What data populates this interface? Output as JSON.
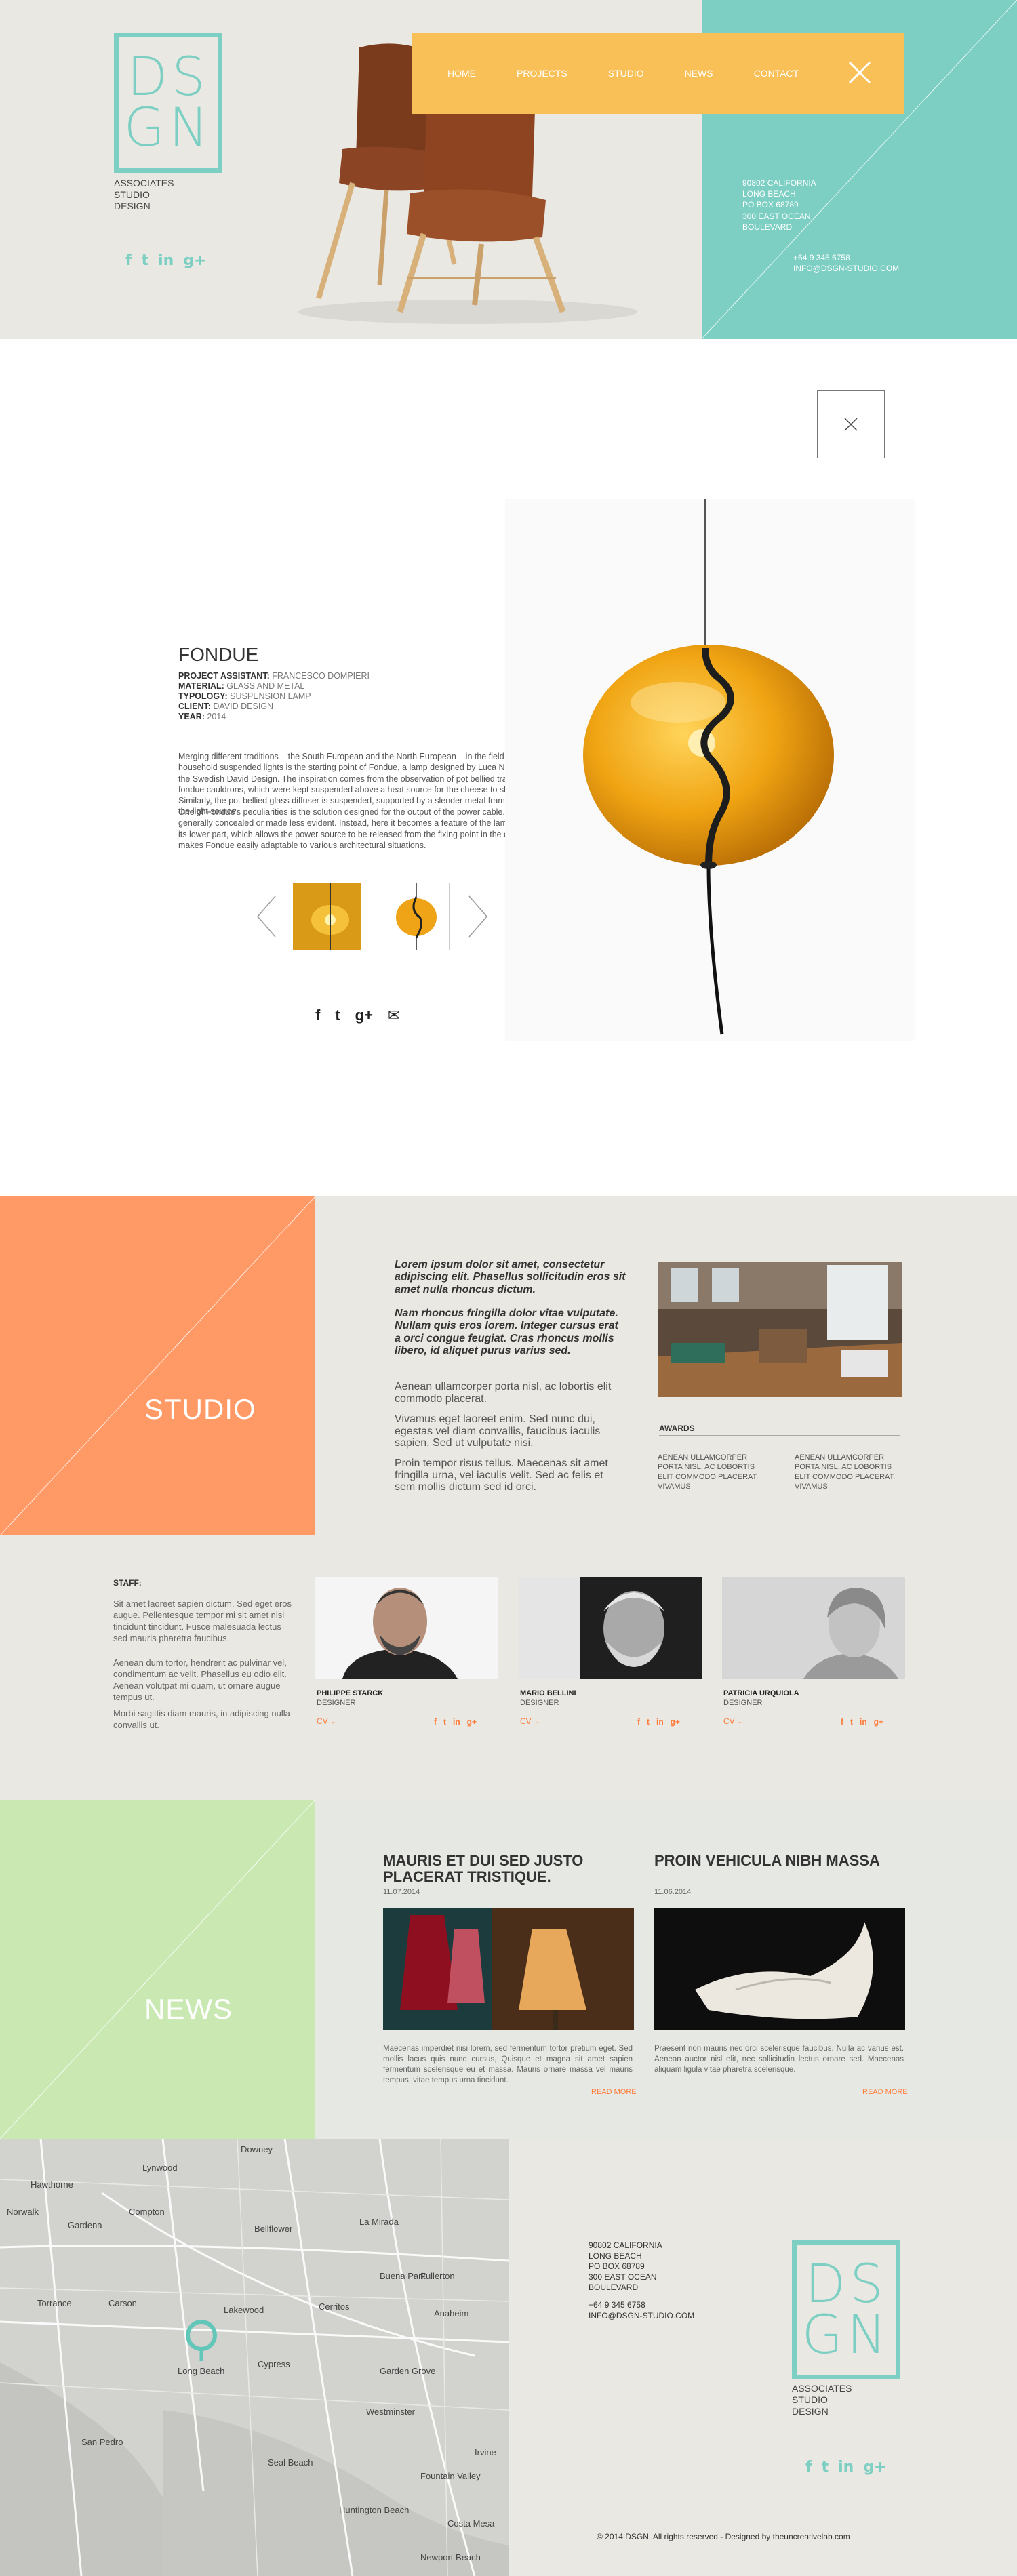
{
  "logo": {
    "letters_top": "DS",
    "letters_bottom": "GN",
    "caption": [
      "ASSOCIATES",
      "STUDIO",
      "DESIGN"
    ]
  },
  "social": {
    "icons": [
      "facebook-icon",
      "twitter-icon",
      "linkedin-icon",
      "googleplus-icon"
    ],
    "glyphs": [
      "f",
      "t",
      "in",
      "g+"
    ]
  },
  "nav": {
    "items": [
      "HOME",
      "PROJECTS",
      "STUDIO",
      "NEWS",
      "CONTACT"
    ]
  },
  "contact": {
    "address": [
      "90802 CALIFORNIA",
      "LONG BEACH",
      "PO BOX 68789",
      "300 EAST OCEAN",
      "BOULEVARD"
    ],
    "phone": "+64 9 345 6758",
    "email": "INFO@DSGN-STUDIO.COM"
  },
  "project": {
    "title": "FONDUE",
    "meta": [
      {
        "label": "PROJECT ASSISTANT:",
        "value": "FRANCESCO DOMPIERI"
      },
      {
        "label": "MATERIAL:",
        "value": "GLASS AND METAL"
      },
      {
        "label": "TYPOLOGY:",
        "value": "SUSPENSION LAMP"
      },
      {
        "label": "CLIENT:",
        "value": "DAVID DESIGN"
      },
      {
        "label": "YEAR:",
        "value": "2014"
      }
    ],
    "para1": "Merging different traditions – the South European and the North European – in the field of household suspended lights is the starting point of Fondue, a lamp designed by Luca Nichetto for the Swedish David Design. The inspiration comes from the observation of pot bellied traditional fondue cauldrons, which were kept suspended above a heat source for the cheese to slowly melt. Similarly, the pot bellied glass diffuser is suspended, supported by a slender metal frame enclosing the light source.",
    "para2": "One of Fondue's peculiarities is the solution designed for the output of the power cable, which is generally concealed or made less evident. Instead, here it becomes a feature of the lamp, located in its lower part, which allows the power source to be released from the fixing point in the ceiling. This makes Fondue easily adaptable to various architectural situations.",
    "share_glyphs": [
      "f",
      "t",
      "g+",
      "✉"
    ]
  },
  "studio": {
    "label": "STUDIO",
    "lead1": "Lorem ipsum dolor sit amet, consectetur adipiscing elit. Phasellus sollicitudin eros sit amet nulla rhoncus dictum.",
    "lead2": "Nam rhoncus fringilla dolor vitae vulputate. Nullam quis eros lorem. Integer cursus erat a orci congue feugiat. Cras rhoncus mollis libero, id aliquet purus varius sed.",
    "p1": "Aenean ullamcorper porta nisl, ac lobortis elit commodo placerat.",
    "p2": "Vivamus eget laoreet enim. Sed nunc dui, egestas vel diam convallis, faucibus iaculis sapien. Sed ut vulputate nisi.",
    "p3": "Proin tempor risus tellus. Maecenas sit amet fringilla urna, vel iaculis velit. Sed ac felis et sem mollis dictum sed id orci.",
    "awards_title": "AWARDS",
    "awards": [
      "AENEAN ULLAMCORPER PORTA NISL, AC LOBORTIS ELIT COMMODO PLACERAT. VIVAMUS",
      "AENEAN ULLAMCORPER PORTA NISL, AC LOBORTIS ELIT COMMODO PLACERAT. VIVAMUS"
    ]
  },
  "staff": {
    "title": "STAFF:",
    "p1": "Sit amet laoreet sapien dictum. Sed eget eros augue. Pellentesque tempor mi sit amet nisi tincidunt tincidunt. Fusce malesuada lectus sed mauris pharetra faucibus.",
    "p2": "Aenean dum tortor, hendrerit ac pulvinar vel, condimentum ac velit. Phasellus eu odio elit. Aenean volutpat mi quam, ut ornare augue tempus ut.",
    "p3": "Morbi sagittis diam mauris, in adipiscing nulla convallis ut.",
    "members": [
      {
        "name": "PHILIPPE STARCK",
        "role": "DESIGNER",
        "cv": "CV"
      },
      {
        "name": "MARIO BELLINI",
        "role": "DESIGNER",
        "cv": "CV"
      },
      {
        "name": "PATRICIA URQUIOLA",
        "role": "DESIGNER",
        "cv": "CV"
      }
    ]
  },
  "news": {
    "label": "NEWS",
    "items": [
      {
        "title": "MAURIS ET DUI SED JUSTO PLACERAT TRISTIQUE.",
        "date": "11.07.2014",
        "body": "Maecenas imperdiet nisi lorem, sed fermentum tortor pretium eget. Sed mollis lacus quis nunc cursus, Quisque et magna sit amet sapien fermentum scelerisque eu et massa. Mauris ornare massa vel mauris tempus, vitae tempus urna tincidunt.",
        "read_more": "READ MORE"
      },
      {
        "title": "PROIN VEHICULA NIBH MASSA",
        "date": "11.06.2014",
        "body": "Praesent non mauris nec orci scelerisque faucibus. Nulla ac varius est. Aenean auctor nisl elit, nec sollicitudin lectus ornare sed. Maecenas aliquam ligula vitae pharetra scelerisque.",
        "read_more": "READ MORE"
      }
    ]
  },
  "map": {
    "places": [
      "Downey",
      "Lynwood",
      "Hawthorne",
      "Norwalk",
      "Compton",
      "La Mirada",
      "Gardena",
      "Bellflower",
      "Torrance",
      "Carson",
      "Lakewood",
      "Cerritos",
      "Buena Park",
      "Fullerton",
      "Long Beach",
      "Anaheim",
      "Garden Grove",
      "Westminster",
      "Fountain Valley",
      "Huntington Beach",
      "Costa Mesa",
      "Newport Beach",
      "Irvine",
      "San Pedro",
      "Cypress",
      "Seal Beach"
    ]
  },
  "footer": {
    "copyright": "© 2014  DSGN. All rights reserved - Designed by theuncreativelab.com"
  }
}
